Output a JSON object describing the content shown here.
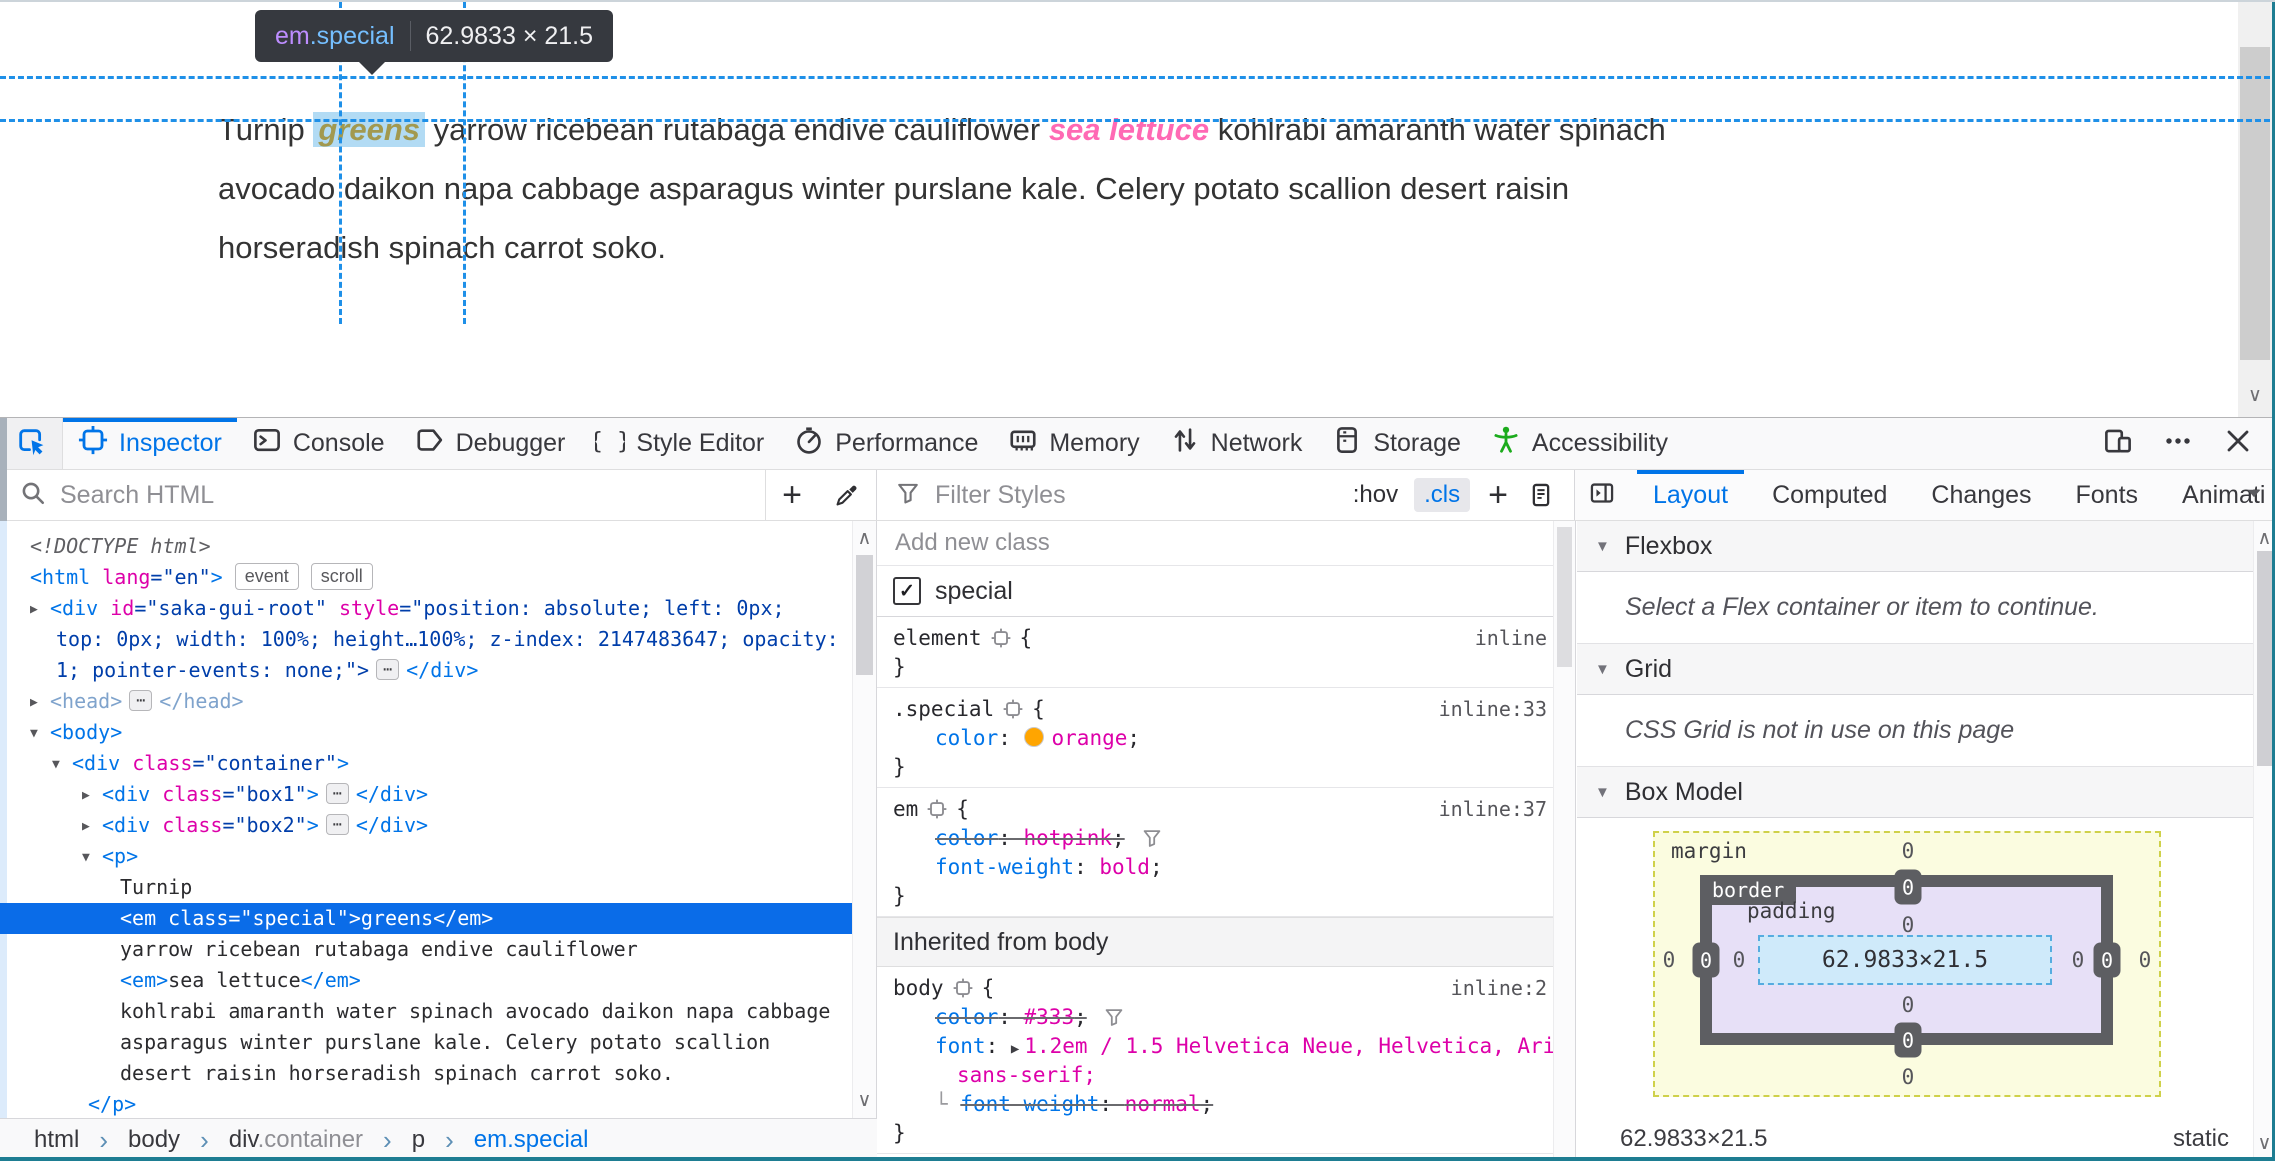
{
  "window": {
    "frame_color": "#1e7d92"
  },
  "page": {
    "tooltip": {
      "tag": "em",
      "cls": ".special",
      "dims": "62.9833 × 21.5"
    },
    "paragraph": {
      "line1_pre": "Turnip ",
      "highlight": "greens",
      "line1_mid": " yarrow ricebean rutabaga endive cauliflower ",
      "em2": "sea lettuce",
      "line1_post": " kohlrabi amaranth water spinach",
      "line2": "avocado daikon napa cabbage asparagus winter purslane kale. Celery potato scallion desert raisin",
      "line3": "horseradish spinach carrot soko."
    },
    "colors": {
      "guide": "#1f90e8",
      "highlight_text": "#a2994f",
      "em2_text": "#ff69b4",
      "body_text": "#333"
    }
  },
  "tabbar": {
    "accent": "#0074e8",
    "tabs": [
      {
        "id": "inspector",
        "label": "Inspector",
        "icon": "inspector-icon",
        "active": true
      },
      {
        "id": "console",
        "label": "Console",
        "icon": "console-icon",
        "active": false
      },
      {
        "id": "debugger",
        "label": "Debugger",
        "icon": "debugger-icon",
        "active": false
      },
      {
        "id": "style-editor",
        "label": "Style Editor",
        "icon": "style-editor-icon",
        "active": false
      },
      {
        "id": "performance",
        "label": "Performance",
        "icon": "performance-icon",
        "active": false
      },
      {
        "id": "memory",
        "label": "Memory",
        "icon": "memory-icon",
        "active": false
      },
      {
        "id": "network",
        "label": "Network",
        "icon": "network-icon",
        "active": false
      },
      {
        "id": "storage",
        "label": "Storage",
        "icon": "storage-icon",
        "active": false
      },
      {
        "id": "accessibility",
        "label": "Accessibility",
        "icon": "accessibility-icon",
        "active": false,
        "green": "#1cab1c"
      }
    ]
  },
  "markup_toolbar": {
    "search_placeholder": "Search HTML"
  },
  "rules_toolbar": {
    "filter_placeholder": "Filter Styles",
    "hov": ":hov",
    "cls": ".cls"
  },
  "sidebar_tabs": [
    {
      "label": "Layout",
      "active": true
    },
    {
      "label": "Computed",
      "active": false
    },
    {
      "label": "Changes",
      "active": false
    },
    {
      "label": "Fonts",
      "active": false
    },
    {
      "label": "Animati",
      "active": false,
      "clipped": true
    }
  ],
  "markup": {
    "lines": [
      {
        "i": 30,
        "parts": [
          {
            "c": "doctype",
            "t": "<!DOCTYPE html>"
          }
        ]
      },
      {
        "i": 30,
        "parts": [
          {
            "c": "tag",
            "t": "<html "
          },
          {
            "c": "attr",
            "t": "lang"
          },
          {
            "c": "val",
            "t": "=\"en\""
          },
          {
            "c": "tag",
            "t": ">"
          },
          {
            "c": "badge",
            "t": "event"
          },
          {
            "c": "badge",
            "t": "scroll"
          }
        ]
      },
      {
        "i": 50,
        "tw": "r",
        "parts": [
          {
            "c": "tag",
            "t": "<div "
          },
          {
            "c": "attr",
            "t": "id"
          },
          {
            "c": "val",
            "t": "=\"saka-gui-root\""
          },
          {
            "c": "txt",
            "t": " "
          },
          {
            "c": "attr",
            "t": "style"
          },
          {
            "c": "val",
            "t": "=\"position: absolute; left: 0px;"
          }
        ]
      },
      {
        "i": 56,
        "parts": [
          {
            "c": "val",
            "t": "top: 0px; width: 100%; height…100%; z-index: 2147483647; opacity:"
          }
        ]
      },
      {
        "i": 56,
        "parts": [
          {
            "c": "val",
            "t": "1; pointer-events: none;\">"
          },
          {
            "c": "chip",
            "t": "⋯"
          },
          {
            "c": "tag",
            "t": "</div>"
          }
        ]
      },
      {
        "i": 50,
        "tw": "r",
        "parts": [
          {
            "c": "faded",
            "t": "<head>"
          },
          {
            "c": "chip",
            "t": "⋯"
          },
          {
            "c": "faded",
            "t": "</head>"
          }
        ]
      },
      {
        "i": 50,
        "tw": "d",
        "parts": [
          {
            "c": "tag",
            "t": "<body>"
          }
        ]
      },
      {
        "i": 72,
        "tw": "d",
        "parts": [
          {
            "c": "tag",
            "t": "<div "
          },
          {
            "c": "attr",
            "t": "class"
          },
          {
            "c": "val",
            "t": "=\"container\""
          },
          {
            "c": "tag",
            "t": ">"
          }
        ]
      },
      {
        "i": 102,
        "tw": "r",
        "parts": [
          {
            "c": "tag",
            "t": "<div "
          },
          {
            "c": "attr",
            "t": "class"
          },
          {
            "c": "val",
            "t": "=\"box1\""
          },
          {
            "c": "tag",
            "t": ">"
          },
          {
            "c": "chip",
            "t": "⋯"
          },
          {
            "c": "tag",
            "t": "</div>"
          }
        ]
      },
      {
        "i": 102,
        "tw": "r",
        "parts": [
          {
            "c": "tag",
            "t": "<div "
          },
          {
            "c": "attr",
            "t": "class"
          },
          {
            "c": "val",
            "t": "=\"box2\""
          },
          {
            "c": "tag",
            "t": ">"
          },
          {
            "c": "chip",
            "t": "⋯"
          },
          {
            "c": "tag",
            "t": "</div>"
          }
        ]
      },
      {
        "i": 102,
        "tw": "d",
        "parts": [
          {
            "c": "tag",
            "t": "<p>"
          }
        ]
      },
      {
        "i": 120,
        "parts": [
          {
            "c": "txt",
            "t": "Turnip"
          }
        ]
      },
      {
        "i": 120,
        "sel": true,
        "parts": [
          {
            "c": "tag",
            "t": "<em "
          },
          {
            "c": "attr",
            "t": "class"
          },
          {
            "c": "val",
            "t": "=\"special\""
          },
          {
            "c": "tag",
            "t": ">"
          },
          {
            "c": "txt",
            "t": "greens"
          },
          {
            "c": "tag",
            "t": "</em>"
          }
        ]
      },
      {
        "i": 120,
        "parts": [
          {
            "c": "txt",
            "t": "yarrow ricebean rutabaga endive cauliflower"
          }
        ]
      },
      {
        "i": 120,
        "parts": [
          {
            "c": "tag",
            "t": "<em>"
          },
          {
            "c": "txt",
            "t": "sea lettuce"
          },
          {
            "c": "tag",
            "t": "</em>"
          }
        ]
      },
      {
        "i": 120,
        "parts": [
          {
            "c": "txt",
            "t": "kohlrabi amaranth water spinach avocado daikon napa cabbage"
          }
        ]
      },
      {
        "i": 120,
        "parts": [
          {
            "c": "txt",
            "t": "asparagus winter purslane kale. Celery potato scallion"
          }
        ]
      },
      {
        "i": 120,
        "parts": [
          {
            "c": "txt",
            "t": "desert raisin horseradish spinach carrot soko."
          }
        ]
      },
      {
        "i": 88,
        "parts": [
          {
            "c": "tag",
            "t": "</p>"
          }
        ]
      }
    ]
  },
  "breadcrumb": {
    "items": [
      {
        "label": "html",
        "active": false
      },
      {
        "label": "body",
        "active": false
      },
      {
        "label": "div",
        "suffix": ".container",
        "active": false
      },
      {
        "label": "p",
        "active": false
      },
      {
        "label": "em.special",
        "active": true
      }
    ]
  },
  "rules": {
    "add_new_class": "Add new class",
    "class_toggle": {
      "label": "special",
      "checked": true
    },
    "inherited_header": "Inherited from body",
    "blocks": [
      {
        "selector": "element",
        "loc": "inline",
        "decls": []
      },
      {
        "selector": ".special",
        "loc": "inline:33",
        "decls": [
          {
            "name": "color",
            "value": "orange",
            "swatch": "#ffa500"
          }
        ]
      },
      {
        "selector": "em",
        "loc": "inline:37",
        "decls": [
          {
            "name": "color",
            "value": "hotpink",
            "struck": true,
            "funnel": true
          },
          {
            "name": "font-weight",
            "value": "bold"
          }
        ]
      },
      {
        "selector": "body",
        "loc": "inline:2",
        "inherited": true,
        "decls": [
          {
            "name": "color",
            "value": "#333",
            "struck": true,
            "funnel": true
          },
          {
            "name": "font",
            "value": "1.2em / 1.5 Helvetica Neue, Helvetica, Arial,",
            "expander": true,
            "wrap": "sans-serif;",
            "nosemi": true
          },
          {
            "name": "font-weight",
            "value": "normal",
            "struck": true,
            "sub": true
          }
        ]
      }
    ]
  },
  "layout_panel": {
    "flexbox_header": "Flexbox",
    "flexbox_message": "Select a Flex container or item to continue.",
    "grid_header": "Grid",
    "grid_message": "CSS Grid is not in use on this page",
    "box_model_header": "Box Model",
    "box_model": {
      "margin_label": "margin",
      "border_label": "border",
      "padding_label": "padding",
      "content_dims": "62.9833×21.5",
      "margin": {
        "top": "0",
        "right": "0",
        "bottom": "0",
        "left": "0"
      },
      "border": {
        "top": "0",
        "right": "0",
        "bottom": "0",
        "left": "0"
      },
      "padding": {
        "top": "0",
        "right": "0",
        "bottom": "0",
        "left": "0"
      }
    },
    "footer": {
      "dimensions": "62.9833×21.5",
      "position": "static"
    }
  }
}
